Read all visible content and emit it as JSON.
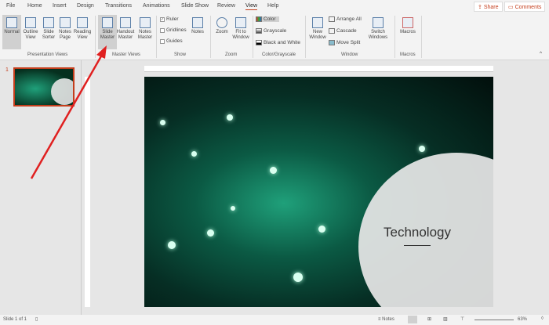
{
  "tabs": [
    "File",
    "Home",
    "Insert",
    "Design",
    "Transitions",
    "Animations",
    "Slide Show",
    "Review",
    "View",
    "Help"
  ],
  "share": "Share",
  "comments": "Comments",
  "ribbon": {
    "presentation_views": {
      "label": "Presentation Views",
      "buttons": [
        "Normal",
        "Outline View",
        "Slide Sorter",
        "Notes Page",
        "Reading View"
      ]
    },
    "master_views": {
      "label": "Master Views",
      "buttons": [
        "Slide Master",
        "Handout Master",
        "Notes Master"
      ]
    },
    "show": {
      "label": "Show",
      "ruler": "Ruler",
      "gridlines": "Gridlines",
      "guides": "Guides",
      "notes": "Notes",
      "ruler_checked": true
    },
    "zoom": {
      "label": "Zoom",
      "zoom": "Zoom",
      "fit": "Fit to Window"
    },
    "color": {
      "label": "Color/Grayscale",
      "color": "Color",
      "grayscale": "Grayscale",
      "bw": "Black and White"
    },
    "window": {
      "label": "Window",
      "new": "New Window",
      "arrange": "Arrange All",
      "cascade": "Cascade",
      "move": "Move Split",
      "switch": "Switch Windows"
    },
    "macros": {
      "label": "Macros",
      "macros": "Macros"
    }
  },
  "thumbnail_number": "1",
  "slide": {
    "title": "Technology"
  },
  "status": {
    "slide": "Slide 1 of 1",
    "notes": "Notes",
    "zoom": "63%"
  },
  "accent": "#c43e1c"
}
